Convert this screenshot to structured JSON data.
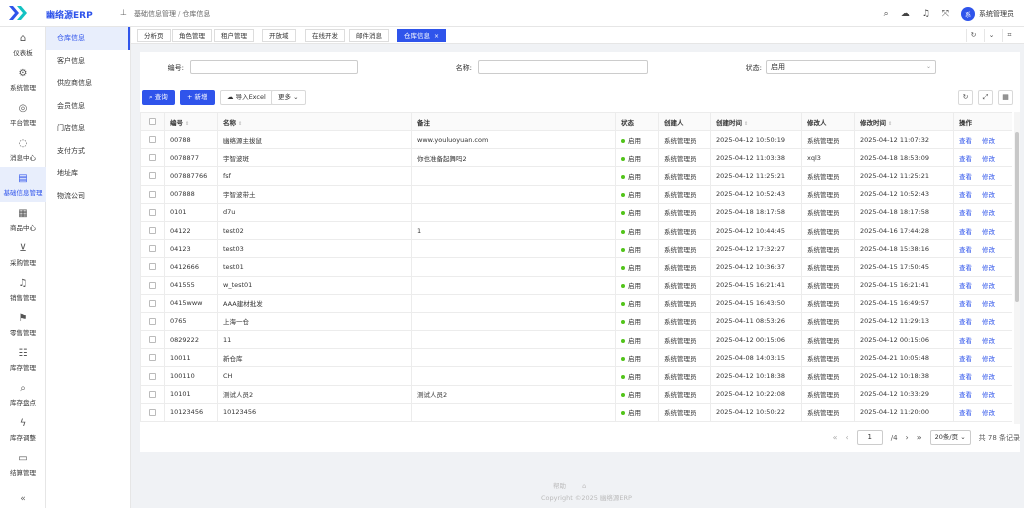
{
  "app": {
    "brand": "幽络源ERP",
    "user": "系统管理员",
    "avatar_text": "系"
  },
  "breadcrumb": {
    "parent": "基础信息管理",
    "current": "仓库信息"
  },
  "rail": [
    {
      "label": "仪表板",
      "icon": "home-icon",
      "glyph": "⌂"
    },
    {
      "label": "系统管理",
      "icon": "gear-icon",
      "glyph": "⚙"
    },
    {
      "label": "平台管理",
      "icon": "globe-icon",
      "glyph": "◎"
    },
    {
      "label": "消息中心",
      "icon": "message-icon",
      "glyph": "◌"
    },
    {
      "label": "基础信息管理",
      "icon": "document-icon",
      "glyph": "▤",
      "active": true
    },
    {
      "label": "商品中心",
      "icon": "grid-icon",
      "glyph": "▦"
    },
    {
      "label": "采购管理",
      "icon": "download-box-icon",
      "glyph": "⊻"
    },
    {
      "label": "销售管理",
      "icon": "bell-icon",
      "glyph": "♫"
    },
    {
      "label": "零售管理",
      "icon": "flag-icon",
      "glyph": "⚑"
    },
    {
      "label": "库存管理",
      "icon": "list-icon",
      "glyph": "☷"
    },
    {
      "label": "库存盘点",
      "icon": "search-icon",
      "glyph": "⌕"
    },
    {
      "label": "库存调整",
      "icon": "lightning-icon",
      "glyph": "ϟ"
    },
    {
      "label": "结算管理",
      "icon": "card-icon",
      "glyph": "▭"
    }
  ],
  "submenu": [
    {
      "label": "仓库信息",
      "active": true
    },
    {
      "label": "客户信息"
    },
    {
      "label": "供应商信息"
    },
    {
      "label": "会员信息"
    },
    {
      "label": "门店信息"
    },
    {
      "label": "支付方式"
    },
    {
      "label": "地址库"
    },
    {
      "label": "物流公司"
    }
  ],
  "tabs": [
    {
      "label": "分析页"
    },
    {
      "label": "角色管理"
    },
    {
      "label": "租户管理"
    },
    {
      "label": "开放域"
    },
    {
      "label": "在线开发"
    },
    {
      "label": "邮件消息"
    },
    {
      "label": "仓库信息",
      "active": true,
      "close": "×"
    }
  ],
  "filters": {
    "code_label": "编号:",
    "code_value": "",
    "name_label": "名称:",
    "name_value": "",
    "status_label": "状态:",
    "status_value": "启用"
  },
  "toolbar": {
    "query": "查询",
    "add": "新增",
    "import": "导入Excel",
    "more": "更多"
  },
  "table": {
    "headers": [
      "编号",
      "名称",
      "备注",
      "状态",
      "创建人",
      "创建时间",
      "修改人",
      "修改时间",
      "操作"
    ],
    "view_label": "查看",
    "edit_label": "修改",
    "rows": [
      {
        "code": "00788",
        "name": "幽络源主拔鼠",
        "remark": "www.youluoyuan.com",
        "status": "启用",
        "creator": "系统管理员",
        "created": "2025-04-12 10:50:19",
        "modifier": "系统管理员",
        "modified": "2025-04-12 11:07:32"
      },
      {
        "code": "0078877",
        "name": "宇智波斑",
        "remark": "你也准备起舞吗2",
        "status": "启用",
        "creator": "系统管理员",
        "created": "2025-04-12 11:03:38",
        "modifier": "xql3",
        "modified": "2025-04-18 18:53:09"
      },
      {
        "code": "007887766",
        "name": "fsf",
        "remark": "",
        "status": "启用",
        "creator": "系统管理员",
        "created": "2025-04-12 11:25:21",
        "modifier": "系统管理员",
        "modified": "2025-04-12 11:25:21"
      },
      {
        "code": "007888",
        "name": "宇智波带土",
        "remark": "",
        "status": "启用",
        "creator": "系统管理员",
        "created": "2025-04-12 10:52:43",
        "modifier": "系统管理员",
        "modified": "2025-04-12 10:52:43"
      },
      {
        "code": "0101",
        "name": "d7u",
        "remark": "",
        "status": "启用",
        "creator": "系统管理员",
        "created": "2025-04-18 18:17:58",
        "modifier": "系统管理员",
        "modified": "2025-04-18 18:17:58"
      },
      {
        "code": "04122",
        "name": "test02",
        "remark": "1",
        "status": "启用",
        "creator": "系统管理员",
        "created": "2025-04-12 10:44:45",
        "modifier": "系统管理员",
        "modified": "2025-04-16 17:44:28"
      },
      {
        "code": "04123",
        "name": "test03",
        "remark": "",
        "status": "启用",
        "creator": "系统管理员",
        "created": "2025-04-12 17:32:27",
        "modifier": "系统管理员",
        "modified": "2025-04-18 15:38:16"
      },
      {
        "code": "0412666",
        "name": "test01",
        "remark": "",
        "status": "启用",
        "creator": "系统管理员",
        "created": "2025-04-12 10:36:37",
        "modifier": "系统管理员",
        "modified": "2025-04-15 17:50:45"
      },
      {
        "code": "041555",
        "name": "w_test01",
        "remark": "",
        "status": "启用",
        "creator": "系统管理员",
        "created": "2025-04-15 16:21:41",
        "modifier": "系统管理员",
        "modified": "2025-04-15 16:21:41"
      },
      {
        "code": "0415www",
        "name": "AAA建材批发",
        "remark": "",
        "status": "启用",
        "creator": "系统管理员",
        "created": "2025-04-15 16:43:50",
        "modifier": "系统管理员",
        "modified": "2025-04-15 16:49:57"
      },
      {
        "code": "0765",
        "name": "上海一仓",
        "remark": "",
        "status": "启用",
        "creator": "系统管理员",
        "created": "2025-04-11 08:53:26",
        "modifier": "系统管理员",
        "modified": "2025-04-12 11:29:13"
      },
      {
        "code": "0829222",
        "name": "11",
        "remark": "",
        "status": "启用",
        "creator": "系统管理员",
        "created": "2025-04-12 00:15:06",
        "modifier": "系统管理员",
        "modified": "2025-04-12 00:15:06"
      },
      {
        "code": "10011",
        "name": "新仓库",
        "remark": "",
        "status": "启用",
        "creator": "系统管理员",
        "created": "2025-04-08 14:03:15",
        "modifier": "系统管理员",
        "modified": "2025-04-21 10:05:48"
      },
      {
        "code": "100110",
        "name": "CH",
        "remark": "",
        "status": "启用",
        "creator": "系统管理员",
        "created": "2025-04-12 10:18:38",
        "modifier": "系统管理员",
        "modified": "2025-04-12 10:18:38"
      },
      {
        "code": "10101",
        "name": "测试人员2",
        "remark": "测试人员2",
        "status": "启用",
        "creator": "系统管理员",
        "created": "2025-04-12 10:22:08",
        "modifier": "系统管理员",
        "modified": "2025-04-12 10:33:29"
      },
      {
        "code": "10123456",
        "name": "10123456",
        "remark": "",
        "status": "启用",
        "creator": "系统管理员",
        "created": "2025-04-12 10:50:22",
        "modifier": "系统管理员",
        "modified": "2025-04-12 11:20:00"
      }
    ]
  },
  "pager": {
    "current": "1",
    "total_pages": "/4",
    "page_size": "20条/页",
    "total": "共 78 条记录"
  },
  "footer": {
    "link1": "帮助",
    "link2": "⌂",
    "copyright": "Copyright ©2025 幽络源ERP"
  },
  "colors": {
    "primary": "#2f54eb",
    "status_on": "#52c41a"
  }
}
